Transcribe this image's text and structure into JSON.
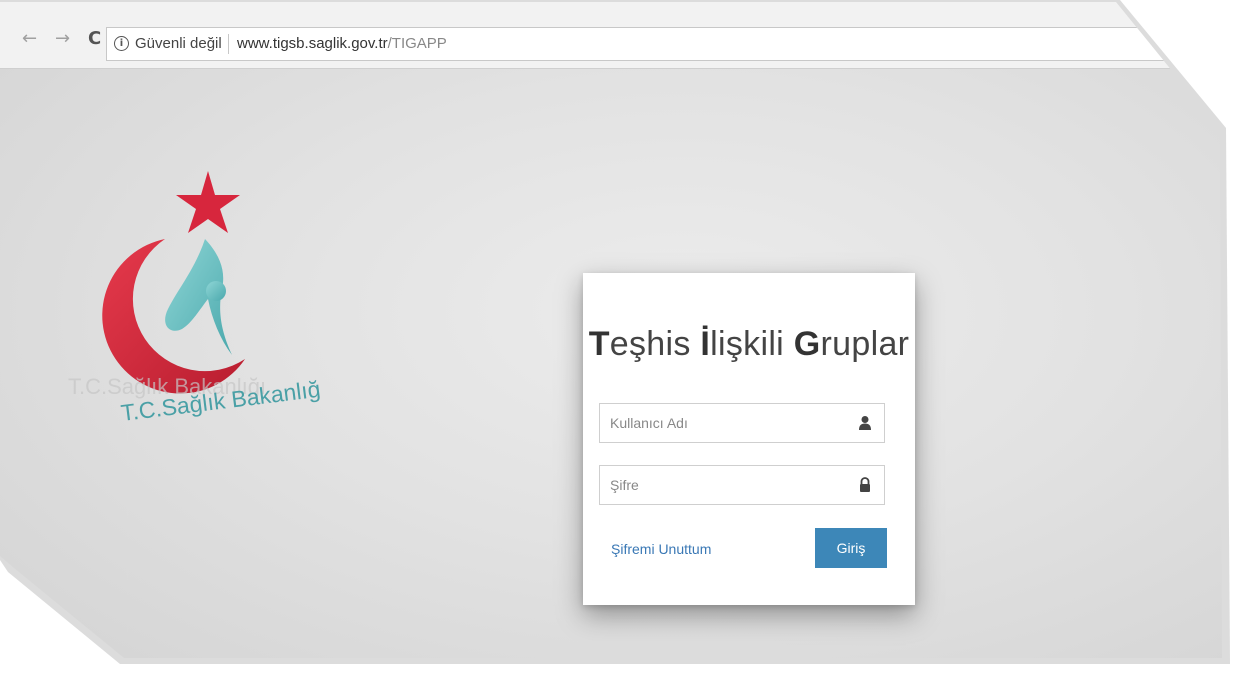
{
  "browser": {
    "security_label": "Güvenli değil",
    "url_host": "www.tigsb.saglik.gov.tr",
    "url_path": "/TIGAPP"
  },
  "logo": {
    "text": "T.C.Sağlık Bakanlığı"
  },
  "login": {
    "title_parts": [
      {
        "text": "T",
        "bold": true
      },
      {
        "text": "eşhis ",
        "bold": false
      },
      {
        "text": "İ",
        "bold": true
      },
      {
        "text": "lişkili ",
        "bold": false
      },
      {
        "text": "G",
        "bold": true
      },
      {
        "text": "ruplar",
        "bold": false
      }
    ],
    "username_placeholder": "Kullanıcı Adı",
    "password_placeholder": "Şifre",
    "forgot_label": "Şifremi Unuttum",
    "submit_label": "Giriş"
  },
  "colors": {
    "accent": "#3d87b8",
    "link": "#3a78b5",
    "logo_red": "#d7263d",
    "logo_teal": "#6fc3c6"
  }
}
